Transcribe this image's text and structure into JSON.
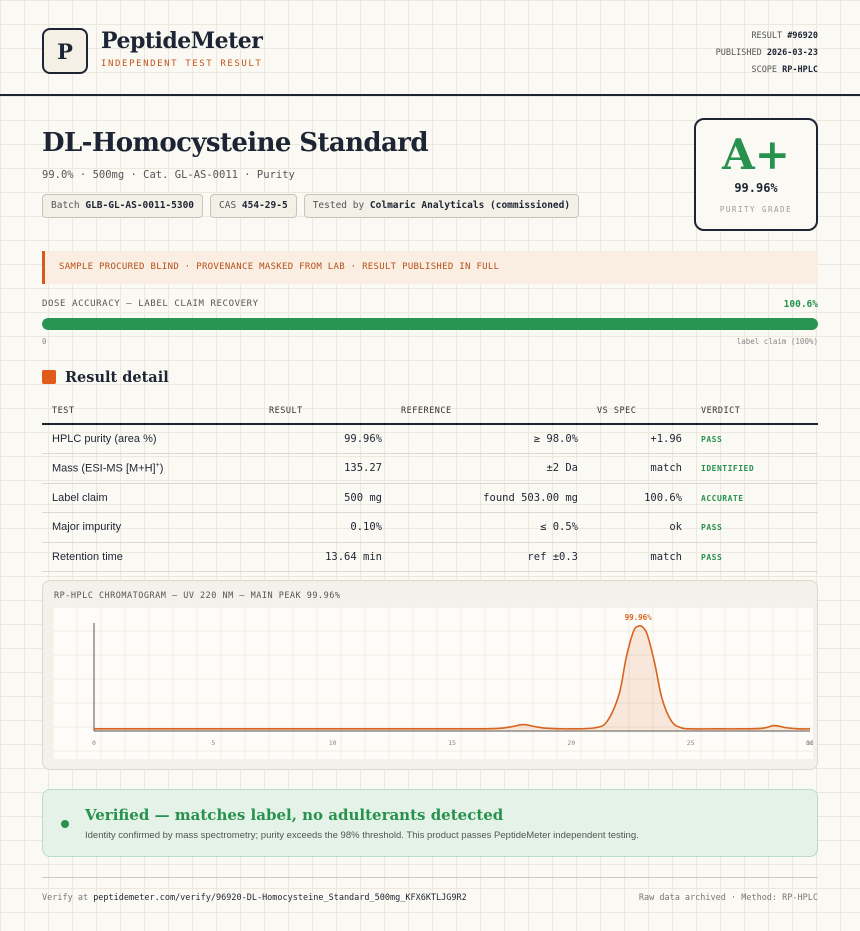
{
  "header": {
    "logo_letter": "P",
    "brand": "PeptideMeter",
    "tagline": "INDEPENDENT TEST RESULT",
    "result_label": "RESULT",
    "result_value": "#96920",
    "published_label": "PUBLISHED",
    "published_value": "2026-03-23",
    "scope_label": "SCOPE",
    "scope_value": "RP-HPLC"
  },
  "product": {
    "title": "DL-Homocysteine Standard",
    "subtitle": "99.0% · 500mg · Cat. GL-AS-0011 · Purity",
    "chips": {
      "batch_label": "Batch",
      "batch_value": "GLB-GL-AS-0011-5300",
      "cas_label": "CAS",
      "cas_value": "454-29-5",
      "tested_label": "Tested by",
      "tested_value": "Colmaric Analyticals (commissioned)"
    }
  },
  "grade": {
    "letter": "A+",
    "percent": "99.96%",
    "label": "PURITY GRADE",
    "color": "#27914e"
  },
  "notice": "SAMPLE PROCURED BLIND · PROVENANCE MASKED FROM LAB · RESULT PUBLISHED IN FULL",
  "dose": {
    "label": "DOSE ACCURACY — LABEL CLAIM RECOVERY",
    "value": "100.6%",
    "fill_fraction": 1.0,
    "min_label": "0",
    "max_label": "label claim (100%)"
  },
  "section_title": "Result detail",
  "table": {
    "headers": {
      "test": "TEST",
      "result": "RESULT",
      "reference": "REFERENCE",
      "vs_spec": "VS SPEC",
      "verdict": "VERDICT"
    },
    "rows": [
      {
        "test": "HPLC purity (area %)",
        "result": "99.96%",
        "reference": "≥ 98.0%",
        "vs_spec": "+1.96",
        "verdict": "PASS"
      },
      {
        "test": "Mass (ESI-MS [M+H]",
        "test_sup": "+",
        "test_end": ")",
        "result": "135.27",
        "reference": "±2 Da",
        "vs_spec": "match",
        "verdict": "IDENTIFIED"
      },
      {
        "test": "Label claim",
        "result": "500 mg",
        "reference": "found 503.00 mg",
        "vs_spec": "100.6%",
        "verdict": "ACCURATE"
      },
      {
        "test": "Major impurity",
        "result": "0.10%",
        "reference": "≤ 0.5%",
        "vs_spec": "ok",
        "verdict": "PASS"
      },
      {
        "test": "Retention time",
        "result": "13.64 min",
        "reference": "ref ±0.3",
        "vs_spec": "match",
        "verdict": "PASS"
      }
    ]
  },
  "chart_data": {
    "type": "line",
    "title": "RP-HPLC CHROMATOGRAM — UV 220 NM — MAIN PEAK 99.96%",
    "xlabel": "",
    "ylabel": "",
    "xlim": [
      0,
      30
    ],
    "ylim": [
      0,
      100
    ],
    "x_ticks": [
      "0",
      "5",
      "10",
      "15",
      "20",
      "25",
      "30"
    ],
    "x_unit": "min",
    "grid": true,
    "peak_label": "99.96%",
    "line_color": "#d8641f",
    "series": [
      {
        "x": [
          0,
          2,
          4,
          6,
          8,
          10,
          12,
          14,
          16,
          17.0,
          17.5,
          18.0,
          18.5,
          19.0,
          20,
          21,
          21.5,
          22.0,
          22.3,
          22.6,
          22.8,
          23.0,
          23.2,
          23.5,
          23.8,
          24.2,
          24.6,
          25,
          26,
          27,
          28.0,
          28.5,
          29.0,
          29.5,
          30
        ],
        "y": [
          2,
          2,
          2,
          2,
          2,
          2,
          2,
          2,
          2,
          2.5,
          4,
          6,
          4,
          2.5,
          2,
          3,
          9,
          34,
          68,
          92,
          97,
          96,
          88,
          62,
          30,
          9,
          3,
          2,
          2,
          2,
          2.5,
          5,
          3,
          2,
          2
        ]
      }
    ]
  },
  "verified": {
    "title": "Verified — matches label, no adulterants detected",
    "text": "Identity confirmed by mass spectrometry; purity exceeds the 98% threshold. This product passes PeptideMeter independent testing."
  },
  "footer": {
    "verify_label": "Verify at",
    "verify_url": "peptidemeter.com/verify/96920-DL-Homocysteine_Standard_500mg_KFX6KTLJG9R2",
    "right": "Raw data archived · Method: RP-HPLC"
  }
}
